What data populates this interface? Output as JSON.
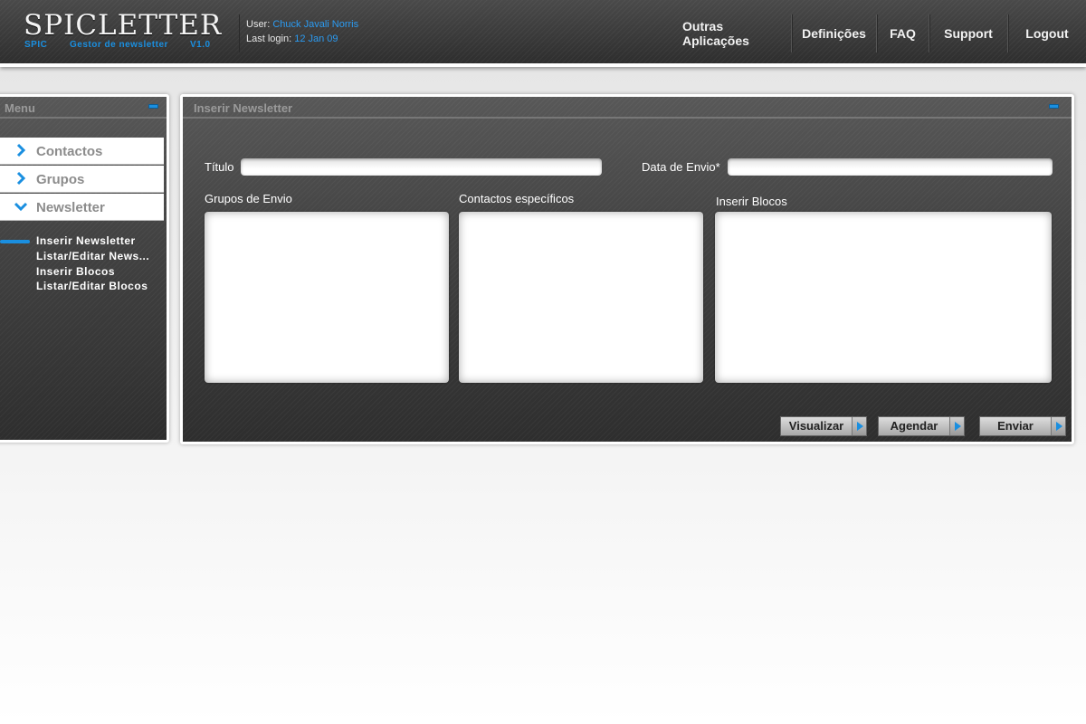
{
  "app": {
    "logo": "SPICLETTER",
    "logo_sub_left": "SPIC",
    "logo_sub_mid": "Gestor de newsletter",
    "logo_sub_right": "V1.0"
  },
  "user_info": {
    "user_label": "User:",
    "user_name": "Chuck Javali Norris",
    "login_label": "Last login:",
    "login_date": "12 Jan 09"
  },
  "nav": [
    {
      "label": "Outras Aplicações"
    },
    {
      "label": "Definições"
    },
    {
      "label": "FAQ"
    },
    {
      "label": "Support"
    },
    {
      "label": "Logout"
    }
  ],
  "sidebar": {
    "title": "Menu",
    "items": [
      {
        "label": "Contactos",
        "icon": "chevron-right-icon"
      },
      {
        "label": "Grupos",
        "icon": "chevron-right-icon"
      },
      {
        "label": "Newsletter",
        "icon": "chevron-down-icon"
      }
    ],
    "subitems": [
      {
        "label": "Inserir Newsletter",
        "active": true
      },
      {
        "label": "Listar/Editar News..."
      },
      {
        "label": "Inserir Blocos"
      },
      {
        "label": "Listar/Editar Blocos"
      }
    ]
  },
  "main": {
    "title": "Inserir Newsletter",
    "titulo_label": "Título",
    "titulo_value": "",
    "data_envio_label": "Data de Envio*",
    "data_envio_value": "",
    "grupos_label": "Grupos de Envio",
    "contactos_label": "Contactos específicos",
    "blocos_label": "Inserir Blocos",
    "buttons": {
      "visualizar": "Visualizar",
      "agendar": "Agendar",
      "enviar": "Enviar"
    }
  },
  "colors": {
    "accent": "#1a8fe0",
    "header_bg": "#3a3a3a",
    "panel_bg": "#3f3f3f"
  }
}
